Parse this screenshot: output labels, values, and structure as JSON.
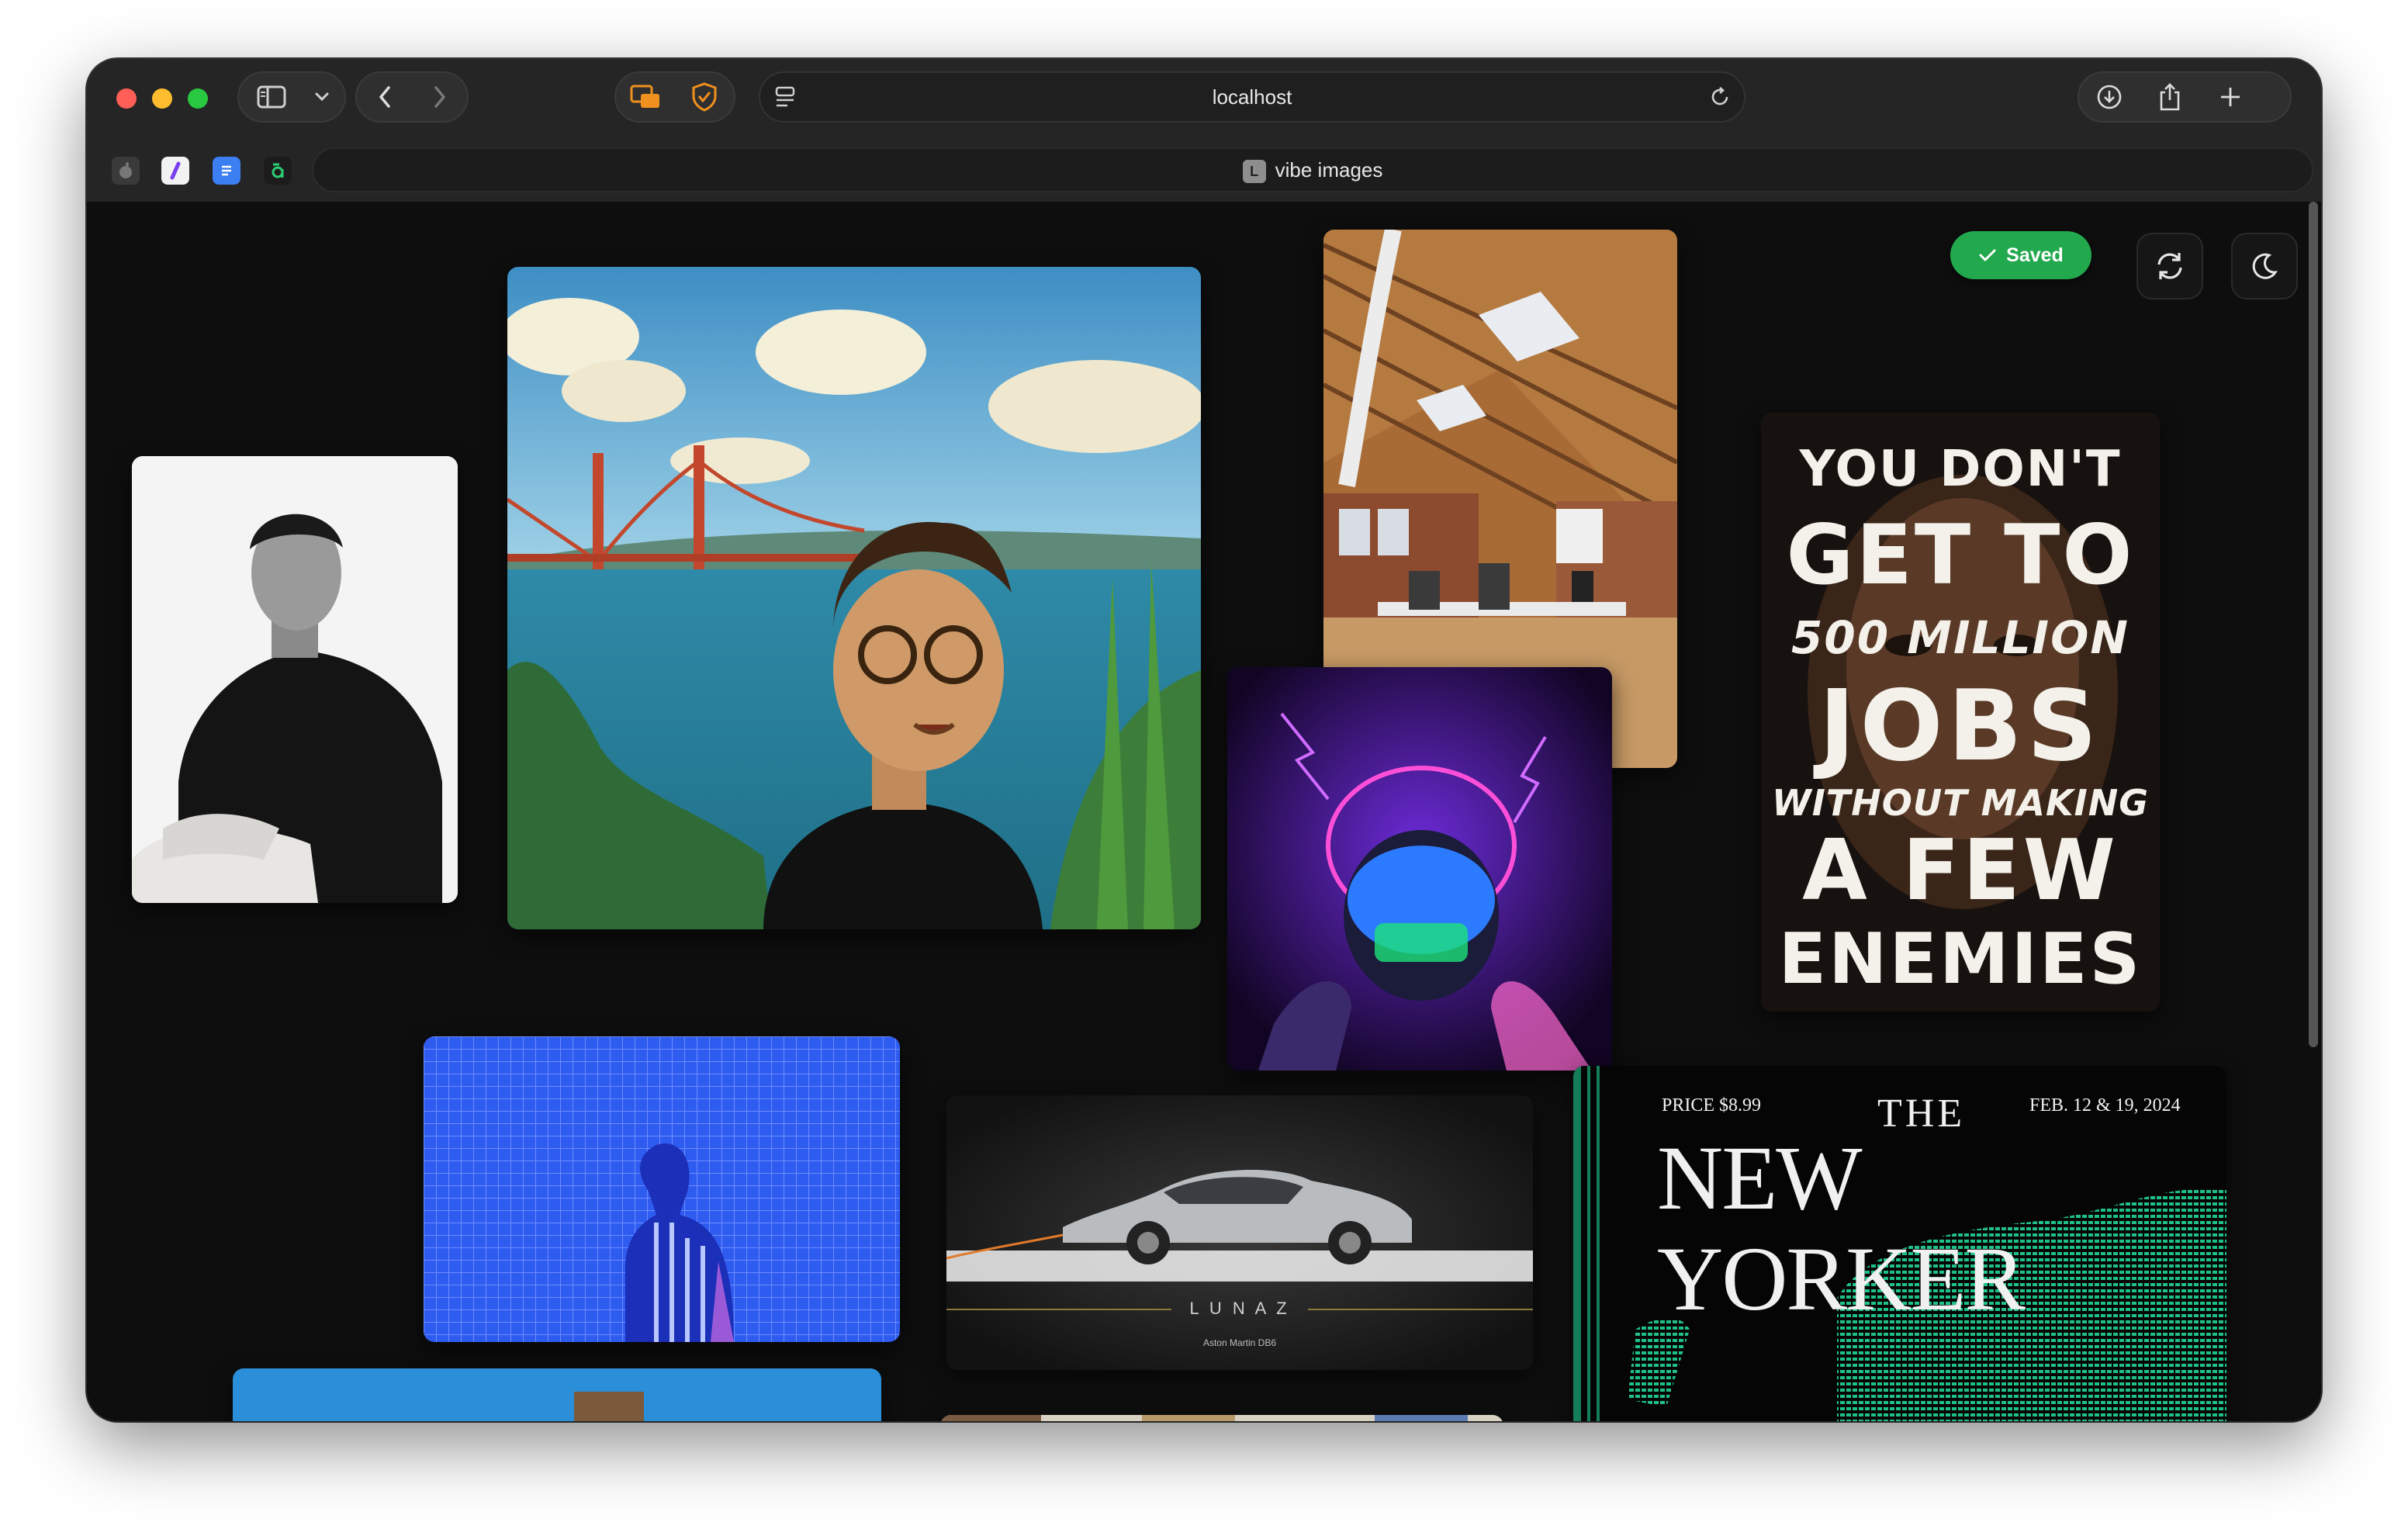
{
  "browser": {
    "url": "localhost",
    "tab_title": "vibe images",
    "tab_favicon_letter": "L"
  },
  "actions": {
    "saved_label": "Saved",
    "refresh_icon": "refresh-icon",
    "theme_icon": "moon-icon"
  },
  "jobs_poster": {
    "line1": "YOU DON'T",
    "line2": "GET TO",
    "line3": "500 MILLION",
    "line4": "JOBS",
    "line5": "WITHOUT MAKING",
    "line6": "A FEW",
    "line7": "ENEMIES"
  },
  "new_yorker": {
    "price": "PRICE $8.99",
    "the": "THE",
    "date": "FEB. 12 & 19, 2024",
    "masthead": "NEW YORKER"
  },
  "car_card": {
    "brand": "L U N A Z",
    "model": "Aston Martin DB6"
  },
  "colors": {
    "saved_green": "#22a84d",
    "page_bg": "#0e0e0e",
    "chrome_bg": "#252525"
  }
}
